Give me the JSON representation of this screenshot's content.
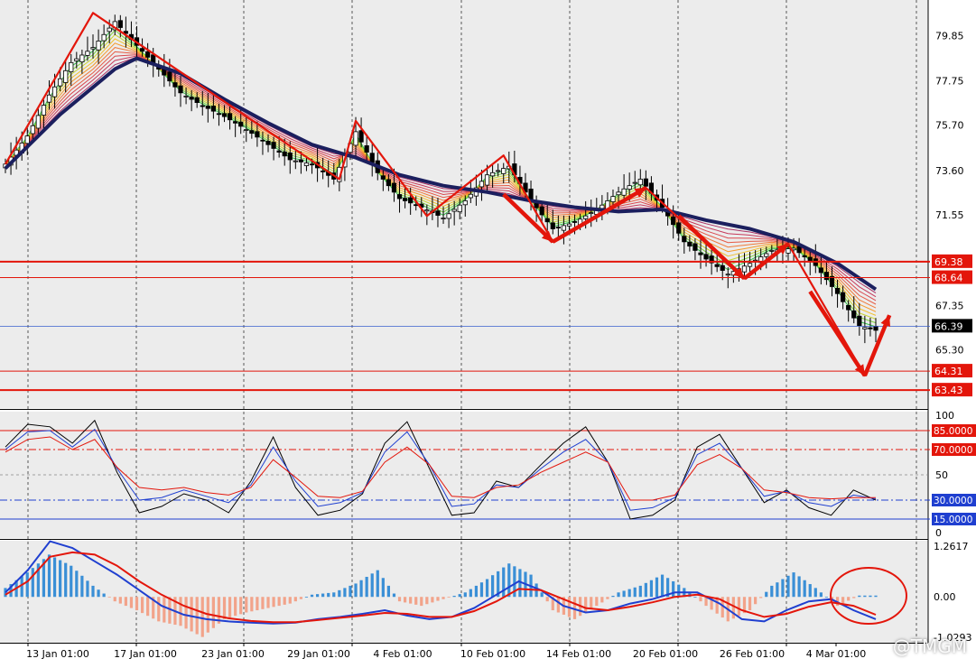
{
  "watermark": "@TMGM",
  "chart_data": [
    {
      "type": "candlestick",
      "panel": "price",
      "y_ticks": [
        "79.85",
        "77.75",
        "75.70",
        "73.60",
        "71.55",
        "67.35",
        "65.30"
      ],
      "ylim": [
        62.6,
        81.5
      ],
      "grid": true,
      "x_tick_labels": [
        "13 Jan 01:00",
        "17 Jan 01:00",
        "23 Jan 01:00",
        "29 Jan 01:00",
        "4 Feb 01:00",
        "10 Feb 01:00",
        "14 Feb 01:00",
        "20 Feb 01:00",
        "26 Feb 01:00",
        "4 Mar 01:00"
      ],
      "close_path": [
        [
          0,
          73.9
        ],
        [
          4,
          75.2
        ],
        [
          8,
          77.1
        ],
        [
          12,
          78.6
        ],
        [
          16,
          79.3
        ],
        [
          20,
          80.5
        ],
        [
          24,
          79.4
        ],
        [
          28,
          78.3
        ],
        [
          32,
          77.2
        ],
        [
          36,
          76.6
        ],
        [
          40,
          76.1
        ],
        [
          44,
          75.5
        ],
        [
          48,
          74.8
        ],
        [
          52,
          74.1
        ],
        [
          56,
          73.9
        ],
        [
          60,
          73.2
        ],
        [
          64,
          75.4
        ],
        [
          68,
          73.5
        ],
        [
          72,
          72.3
        ],
        [
          76,
          71.9
        ],
        [
          80,
          71.4
        ],
        [
          84,
          72.2
        ],
        [
          88,
          73.4
        ],
        [
          92,
          73.8
        ],
        [
          96,
          72.2
        ],
        [
          100,
          70.9
        ],
        [
          104,
          71.2
        ],
        [
          108,
          71.8
        ],
        [
          112,
          72.6
        ],
        [
          116,
          73.2
        ],
        [
          120,
          71.9
        ],
        [
          124,
          70.3
        ],
        [
          128,
          69.5
        ],
        [
          132,
          68.8
        ],
        [
          136,
          69.3
        ],
        [
          140,
          69.9
        ],
        [
          144,
          70.0
        ],
        [
          148,
          69.2
        ],
        [
          152,
          67.9
        ],
        [
          156,
          66.4
        ],
        [
          159,
          66.2
        ]
      ],
      "ema_thick": [
        [
          0,
          73.7
        ],
        [
          10,
          76.2
        ],
        [
          20,
          78.3
        ],
        [
          24,
          78.8
        ],
        [
          32,
          78.1
        ],
        [
          40,
          76.9
        ],
        [
          48,
          75.8
        ],
        [
          56,
          74.8
        ],
        [
          64,
          74.2
        ],
        [
          72,
          73.4
        ],
        [
          80,
          72.9
        ],
        [
          88,
          72.6
        ],
        [
          96,
          72.2
        ],
        [
          104,
          71.9
        ],
        [
          112,
          71.7
        ],
        [
          120,
          71.8
        ],
        [
          128,
          71.3
        ],
        [
          136,
          70.9
        ],
        [
          144,
          70.3
        ],
        [
          152,
          69.3
        ],
        [
          159,
          68.1
        ]
      ],
      "horizontal_levels": [
        {
          "label": "69.38",
          "value": 69.38,
          "color": "#e3160b"
        },
        {
          "label": "68.64",
          "value": 68.64,
          "color": "#e3160b"
        },
        {
          "label": "66.39",
          "value": 66.39,
          "color": "#3a5fcd",
          "current": true
        },
        {
          "label": "64.31",
          "value": 64.31,
          "color": "#e3160b"
        },
        {
          "label": "63.43",
          "value": 63.43,
          "color": "#e3160b"
        }
      ],
      "trend_zigzag": [
        [
          0,
          73.9
        ],
        [
          16,
          80.9
        ],
        [
          61,
          73.2
        ],
        [
          64,
          75.9
        ],
        [
          77,
          71.5
        ],
        [
          91,
          74.3
        ],
        [
          100,
          70.3
        ],
        [
          117,
          72.8
        ],
        [
          135,
          68.6
        ],
        [
          143,
          70.2
        ],
        [
          157,
          64.1
        ],
        [
          161,
          66.7
        ]
      ]
    },
    {
      "type": "line",
      "panel": "stochastic",
      "y_ticks": [
        "100",
        "50",
        "0"
      ],
      "ylim": [
        0,
        100
      ],
      "levels": [
        {
          "label": "85.0000",
          "value": 85,
          "color": "#e3160b"
        },
        {
          "label": "70.0000",
          "value": 70,
          "color": "#e3160b"
        },
        {
          "label": "30.0000",
          "value": 30,
          "color": "#1f3fd0"
        },
        {
          "label": "15.0000",
          "value": 15,
          "color": "#1f3fd0"
        }
      ],
      "series": [
        {
          "color": "#000000",
          "values": [
            72,
            90,
            88,
            75,
            93,
            52,
            20,
            25,
            35,
            30,
            20,
            45,
            80,
            40,
            18,
            22,
            35,
            75,
            92,
            55,
            18,
            20,
            45,
            40,
            58,
            75,
            88,
            60,
            15,
            18,
            30,
            72,
            82,
            55,
            28,
            38,
            24,
            18,
            38,
            30
          ]
        },
        {
          "color": "#1f3fd0",
          "values": [
            70,
            84,
            85,
            72,
            86,
            55,
            30,
            32,
            38,
            33,
            28,
            42,
            72,
            45,
            25,
            28,
            36,
            68,
            84,
            58,
            25,
            27,
            42,
            40,
            55,
            68,
            78,
            60,
            22,
            24,
            32,
            66,
            75,
            55,
            33,
            37,
            28,
            25,
            34,
            31
          ]
        },
        {
          "color": "#e3160b",
          "values": [
            68,
            78,
            80,
            70,
            78,
            56,
            40,
            38,
            40,
            36,
            34,
            40,
            62,
            48,
            33,
            32,
            37,
            60,
            72,
            58,
            33,
            32,
            40,
            42,
            52,
            60,
            68,
            60,
            30,
            30,
            34,
            58,
            66,
            55,
            38,
            36,
            32,
            31,
            32,
            32
          ]
        }
      ]
    },
    {
      "type": "bar",
      "panel": "macd",
      "y_ticks": [
        "1.2617",
        "0.00",
        "-1.0293"
      ],
      "ylim": [
        -1.0293,
        1.2617
      ],
      "histogram": [
        0.2,
        0.55,
        0.95,
        0.7,
        0.25,
        -0.1,
        -0.3,
        -0.55,
        -0.65,
        -0.9,
        -0.5,
        -0.35,
        -0.25,
        -0.15,
        0.05,
        0.1,
        0.3,
        0.6,
        -0.1,
        -0.2,
        -0.05,
        0.1,
        0.4,
        0.75,
        0.5,
        -0.3,
        -0.5,
        -0.2,
        0.1,
        0.25,
        0.5,
        0.2,
        -0.2,
        -0.55,
        -0.3,
        0.25,
        0.55,
        0.2,
        -0.2,
        0.03
      ],
      "series": [
        {
          "color": "#1f3fd0",
          "values": [
            0.1,
            0.6,
            1.25,
            1.1,
            0.8,
            0.5,
            0.15,
            -0.2,
            -0.4,
            -0.5,
            -0.55,
            -0.58,
            -0.6,
            -0.58,
            -0.5,
            -0.45,
            -0.38,
            -0.3,
            -0.42,
            -0.5,
            -0.45,
            -0.25,
            0.05,
            0.35,
            0.15,
            -0.2,
            -0.35,
            -0.3,
            -0.15,
            -0.05,
            0.1,
            0.1,
            -0.15,
            -0.5,
            -0.55,
            -0.3,
            -0.1,
            -0.05,
            -0.3,
            -0.5
          ]
        },
        {
          "color": "#e3160b",
          "values": [
            0.05,
            0.35,
            0.9,
            1.0,
            0.95,
            0.7,
            0.35,
            0.05,
            -0.2,
            -0.38,
            -0.48,
            -0.54,
            -0.57,
            -0.57,
            -0.52,
            -0.47,
            -0.42,
            -0.36,
            -0.38,
            -0.45,
            -0.45,
            -0.32,
            -0.1,
            0.18,
            0.15,
            -0.05,
            -0.25,
            -0.3,
            -0.22,
            -0.12,
            0.0,
            0.05,
            -0.05,
            -0.3,
            -0.45,
            -0.38,
            -0.22,
            -0.12,
            -0.2,
            -0.4
          ]
        }
      ]
    }
  ]
}
